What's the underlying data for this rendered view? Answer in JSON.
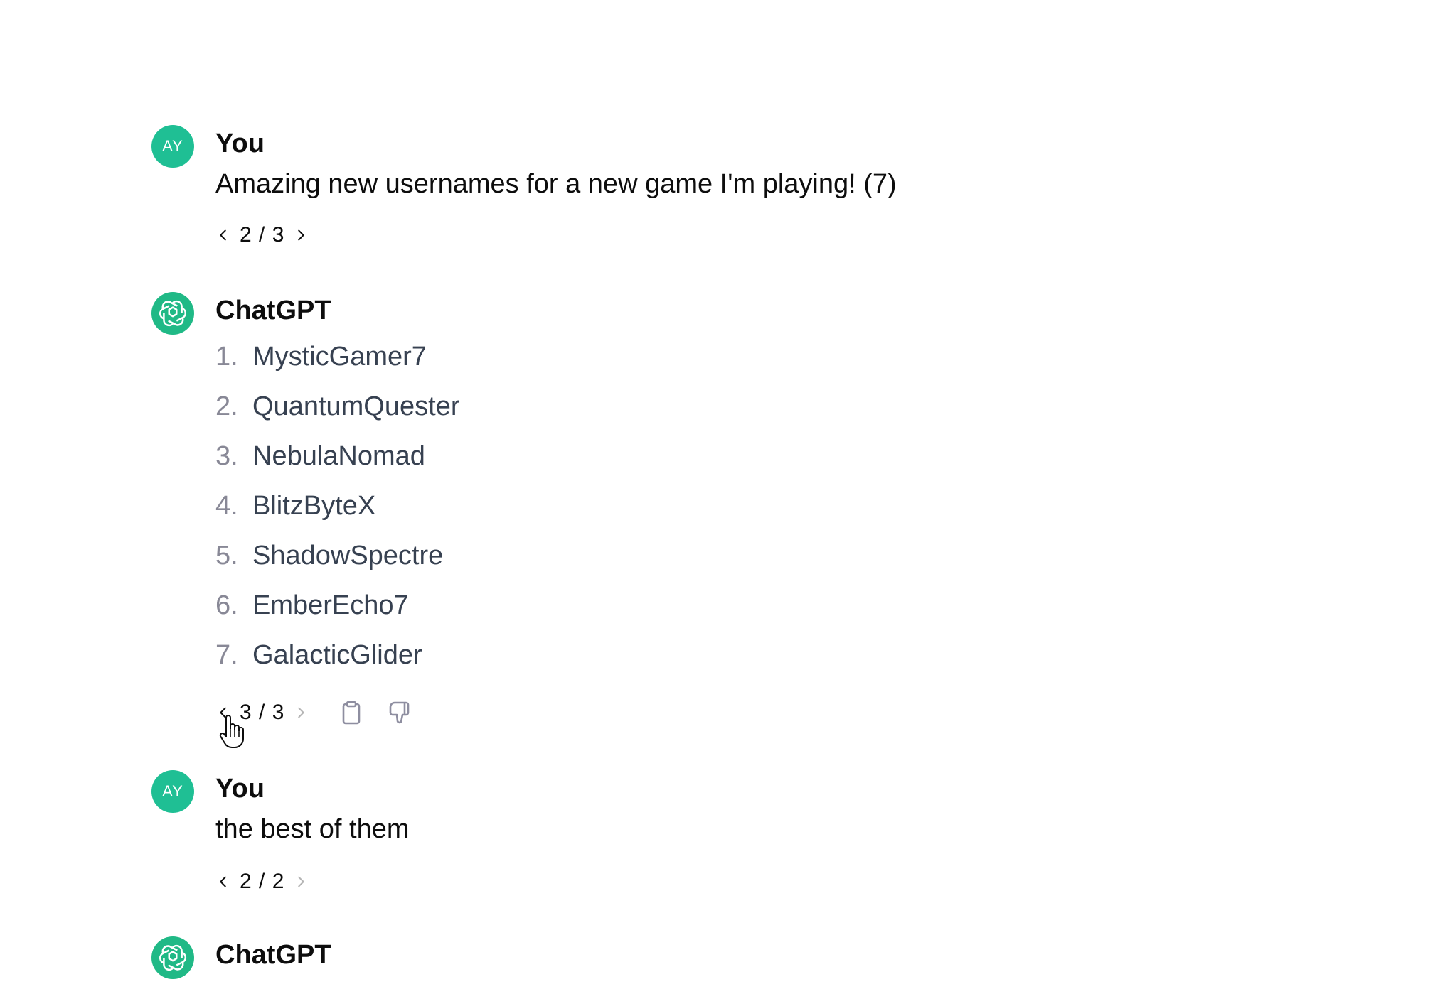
{
  "messages": [
    {
      "author": "You",
      "avatar_initials": "AY",
      "text": "Amazing new usernames for a new game I'm playing! (7)",
      "pager": "2 / 3"
    },
    {
      "author": "ChatGPT",
      "avatar_icon": "openai-logo-icon",
      "list": [
        {
          "num": "1.",
          "name": "MysticGamer7"
        },
        {
          "num": "2.",
          "name": "QuantumQuester"
        },
        {
          "num": "3.",
          "name": "NebulaNomad"
        },
        {
          "num": "4.",
          "name": "BlitzByteX"
        },
        {
          "num": "5.",
          "name": "ShadowSpectre"
        },
        {
          "num": "6.",
          "name": "EmberEcho7"
        },
        {
          "num": "7.",
          "name": "GalacticGlider"
        }
      ],
      "pager": "3 / 3",
      "actions": [
        "clipboard-icon",
        "thumbs-down-icon"
      ]
    },
    {
      "author": "You",
      "avatar_initials": "AY",
      "text": "the best of them",
      "pager": "2 / 2"
    },
    {
      "author": "ChatGPT",
      "avatar_icon": "openai-logo-icon"
    }
  ],
  "colors": {
    "user_avatar": "#1fbf94",
    "bot_avatar": "#20b986",
    "list_text": "#374151",
    "list_number": "#888896",
    "text": "#0d0d0d"
  }
}
